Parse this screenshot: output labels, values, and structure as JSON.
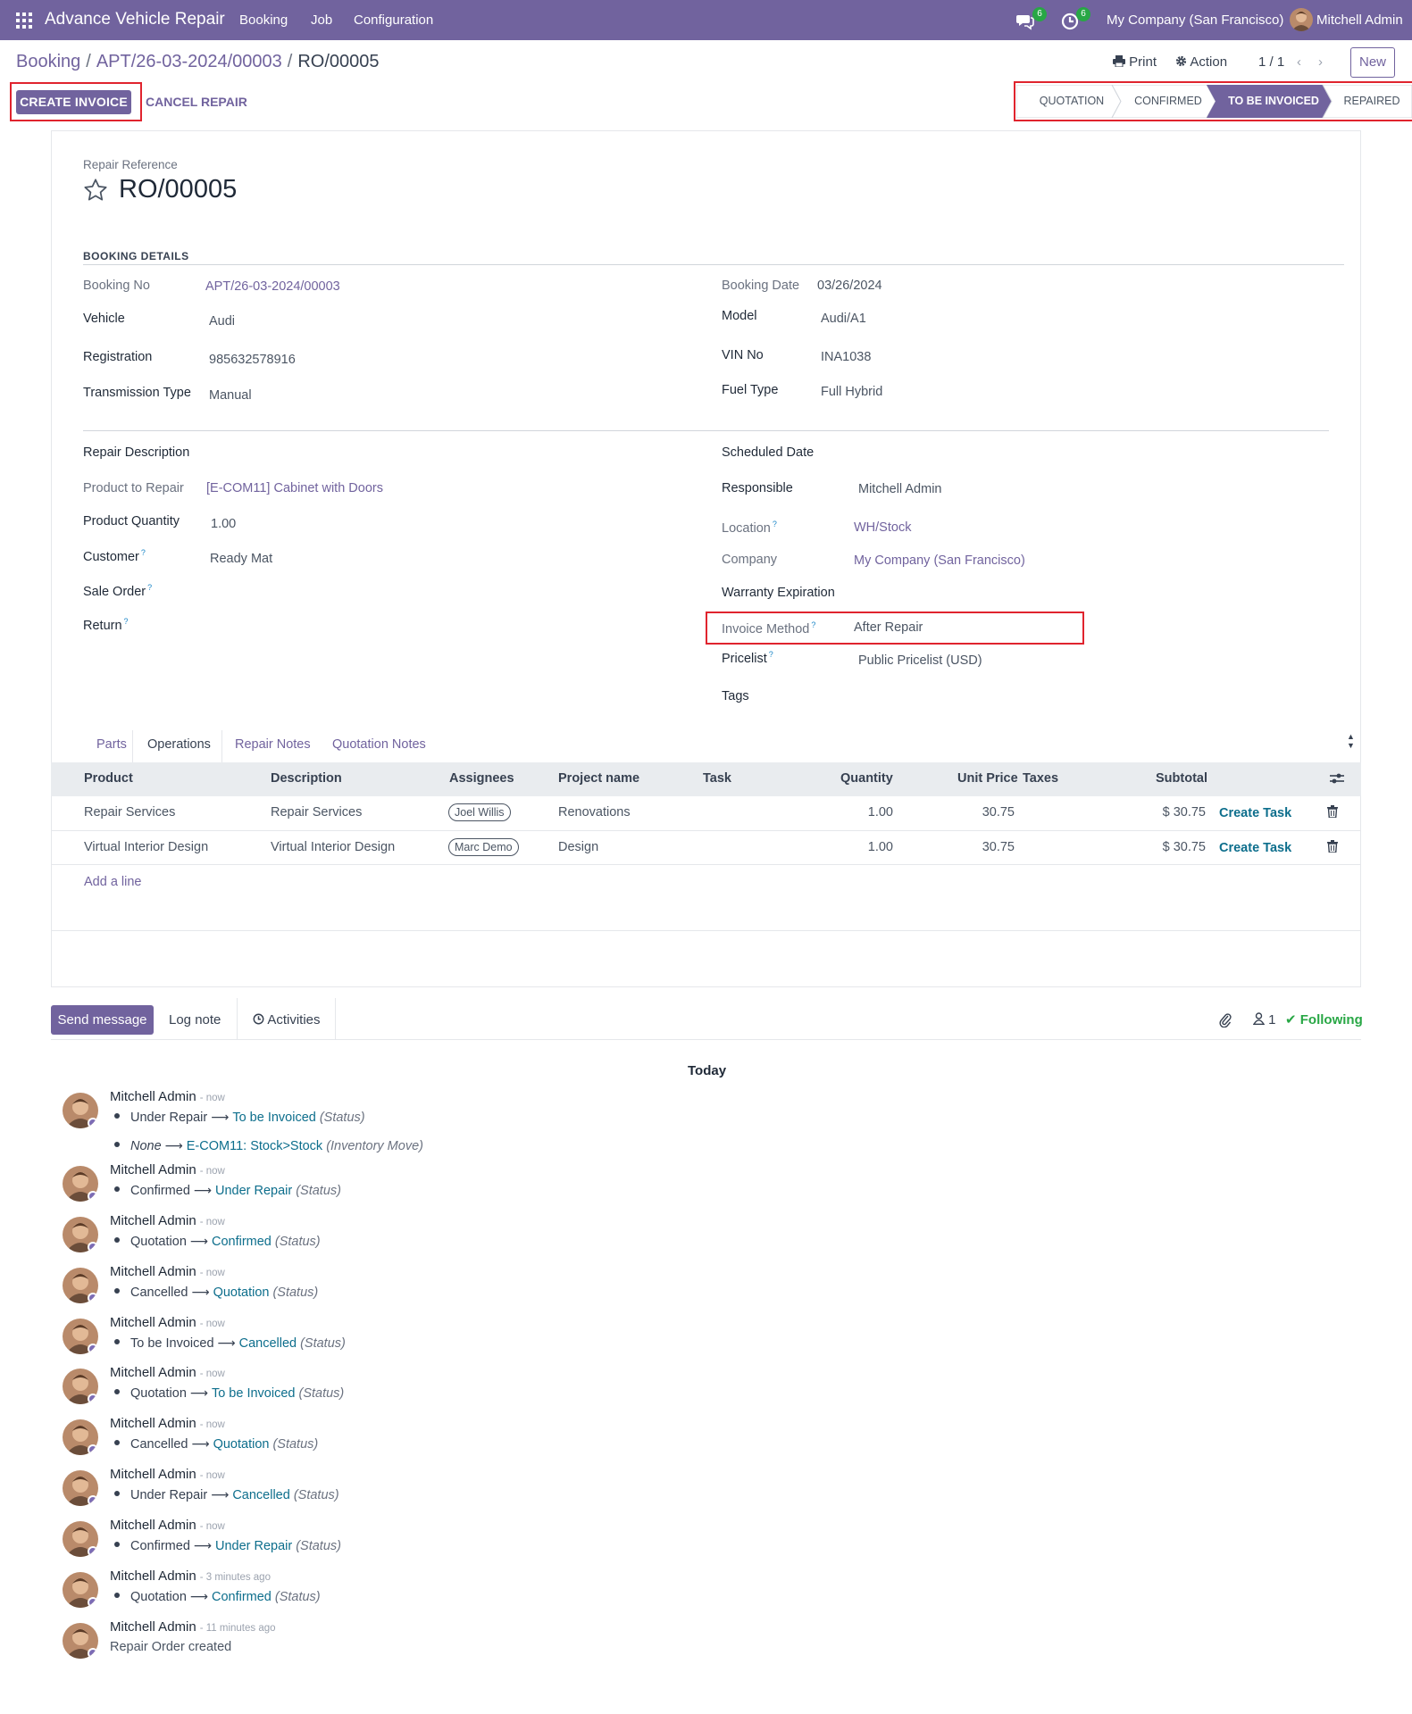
{
  "topnav": {
    "app_title": "Advance Vehicle Repair",
    "menus": [
      "Booking",
      "Job",
      "Configuration"
    ],
    "messages_count": "6",
    "activities_count": "6",
    "company": "My Company (San Francisco)",
    "user": "Mitchell Admin"
  },
  "breadcrumb": {
    "items": [
      "Booking",
      "APT/26-03-2024/00003"
    ],
    "current": "RO/00005"
  },
  "control": {
    "print_label": "Print",
    "action_label": "Action",
    "pager": "1 / 1",
    "new_label": "New"
  },
  "actions": {
    "create_invoice": "CREATE INVOICE",
    "cancel_repair": "CANCEL REPAIR"
  },
  "statusbar": {
    "stages": [
      "QUOTATION",
      "CONFIRMED",
      "TO BE INVOICED",
      "REPAIRED"
    ],
    "active": "TO BE INVOICED"
  },
  "form": {
    "ref_label": "Repair Reference",
    "ref_value": "RO/00005",
    "booking_section": "BOOKING DETAILS",
    "booking_no_label": "Booking No",
    "booking_no": "APT/26-03-2024/00003",
    "booking_date_label": "Booking Date",
    "booking_date": "03/26/2024",
    "vehicle_label": "Vehicle",
    "vehicle": "Audi",
    "model_label": "Model",
    "model": "Audi/A1",
    "registration_label": "Registration",
    "registration": "985632578916",
    "vin_label": "VIN No",
    "vin": "INA1038",
    "transmission_label": "Transmission Type",
    "transmission": "Manual",
    "fuel_label": "Fuel Type",
    "fuel": "Full Hybrid",
    "repair_desc_label": "Repair Description",
    "scheduled_date_label": "Scheduled Date",
    "product_label": "Product to Repair",
    "product": "[E-COM11] Cabinet with Doors",
    "responsible_label": "Responsible",
    "responsible": "Mitchell Admin",
    "qty_label": "Product Quantity",
    "qty": "1.00",
    "location_label": "Location",
    "location": "WH/Stock",
    "customer_label": "Customer",
    "customer": "Ready Mat",
    "company_label": "Company",
    "company": "My Company (San Francisco)",
    "sale_order_label": "Sale Order",
    "warranty_label": "Warranty Expiration",
    "return_label": "Return",
    "invoice_method_label": "Invoice Method",
    "invoice_method": "After Repair",
    "pricelist_label": "Pricelist",
    "pricelist": "Public Pricelist (USD)",
    "tags_label": "Tags",
    "help_mark": "?"
  },
  "tabs": [
    "Parts",
    "Operations",
    "Repair Notes",
    "Quotation Notes"
  ],
  "table": {
    "columns": [
      "Product",
      "Description",
      "Assignees",
      "Project name",
      "Task",
      "Quantity",
      "Unit Price",
      "Taxes",
      "Subtotal"
    ],
    "rows": [
      {
        "product": "Repair Services",
        "description": "Repair Services",
        "assignee": "Joel Willis",
        "project": "Renovations",
        "quantity": "1.00",
        "unit_price": "30.75",
        "subtotal": "$ 30.75",
        "action": "Create Task"
      },
      {
        "product": "Virtual Interior Design",
        "description": "Virtual Interior Design",
        "assignee": "Marc Demo",
        "project": "Design",
        "quantity": "1.00",
        "unit_price": "30.75",
        "subtotal": "$ 30.75",
        "action": "Create Task"
      }
    ],
    "add_line": "Add a line"
  },
  "chatter": {
    "send_message": "Send message",
    "log_note": "Log note",
    "activities": "Activities",
    "followers_count": "1",
    "following": "Following",
    "today": "Today",
    "messages": [
      {
        "author": "Mitchell Admin",
        "time": "- now",
        "changes": [
          {
            "old": "Under Repair",
            "new": "To be Invoiced",
            "field": "(Status)"
          },
          {
            "old": "None",
            "new": "E-COM11: Stock>Stock",
            "field": "(Inventory Move)"
          }
        ]
      },
      {
        "author": "Mitchell Admin",
        "time": "- now",
        "changes": [
          {
            "old": "Confirmed",
            "new": "Under Repair",
            "field": "(Status)"
          }
        ]
      },
      {
        "author": "Mitchell Admin",
        "time": "- now",
        "changes": [
          {
            "old": "Quotation",
            "new": "Confirmed",
            "field": "(Status)"
          }
        ]
      },
      {
        "author": "Mitchell Admin",
        "time": "- now",
        "changes": [
          {
            "old": "Cancelled",
            "new": "Quotation",
            "field": "(Status)"
          }
        ]
      },
      {
        "author": "Mitchell Admin",
        "time": "- now",
        "changes": [
          {
            "old": "To be Invoiced",
            "new": "Cancelled",
            "field": "(Status)"
          }
        ]
      },
      {
        "author": "Mitchell Admin",
        "time": "- now",
        "changes": [
          {
            "old": "Quotation",
            "new": "To be Invoiced",
            "field": "(Status)"
          }
        ]
      },
      {
        "author": "Mitchell Admin",
        "time": "- now",
        "changes": [
          {
            "old": "Cancelled",
            "new": "Quotation",
            "field": "(Status)"
          }
        ]
      },
      {
        "author": "Mitchell Admin",
        "time": "- now",
        "changes": [
          {
            "old": "Under Repair",
            "new": "Cancelled",
            "field": "(Status)"
          }
        ]
      },
      {
        "author": "Mitchell Admin",
        "time": "- now",
        "changes": [
          {
            "old": "Confirmed",
            "new": "Under Repair",
            "field": "(Status)"
          }
        ]
      },
      {
        "author": "Mitchell Admin",
        "time": "- 3 minutes ago",
        "changes": [
          {
            "old": "Quotation",
            "new": "Confirmed",
            "field": "(Status)"
          }
        ]
      },
      {
        "author": "Mitchell Admin",
        "time": "- 11 minutes ago",
        "body": "Repair Order created"
      }
    ]
  },
  "colors": {
    "brand": "#71639e",
    "link_teal": "#0d6e8c",
    "highlight_red": "#e0242e",
    "success": "#28a745"
  }
}
